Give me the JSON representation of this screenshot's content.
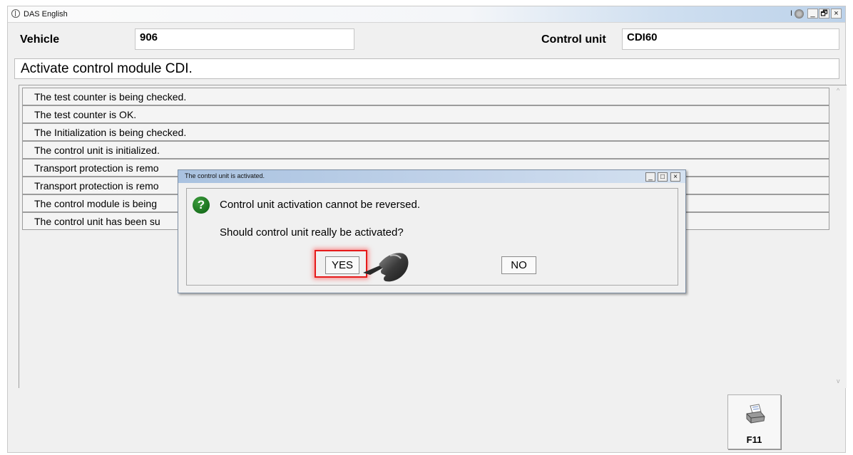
{
  "app": {
    "title": "DAS English",
    "title_extra": "I",
    "controls": [
      "_",
      "🗗",
      "×"
    ]
  },
  "header": {
    "vehicle_label": "Vehicle",
    "vehicle_value": "906",
    "control_unit_label": "Control unit",
    "control_unit_value": "CDI60"
  },
  "instruction": "Activate control module CDI.",
  "status_list": [
    "The test counter is being checked.",
    "The test counter is OK.",
    "The Initialization is being checked.",
    "The control unit is initialized.",
    "Transport protection is remo",
    "Transport protection is remo",
    "The control module is being",
    "The control unit has been su"
  ],
  "scrollbar": {
    "up": "^",
    "down": "v"
  },
  "print_button": {
    "label": "F11",
    "icon": "printer-icon"
  },
  "dialog": {
    "title": "The control unit is activated.",
    "controls": [
      "_",
      "□",
      "×"
    ],
    "icon_glyph": "?",
    "message_1": "Control unit activation cannot be reversed.",
    "message_2": "Should control unit really be activated?",
    "yes_label": "YES",
    "no_label": "NO"
  },
  "colors": {
    "highlight": "#e51a1a",
    "question_icon": "#0b5f12",
    "dialog_title_bar": "#a9c2e0"
  }
}
